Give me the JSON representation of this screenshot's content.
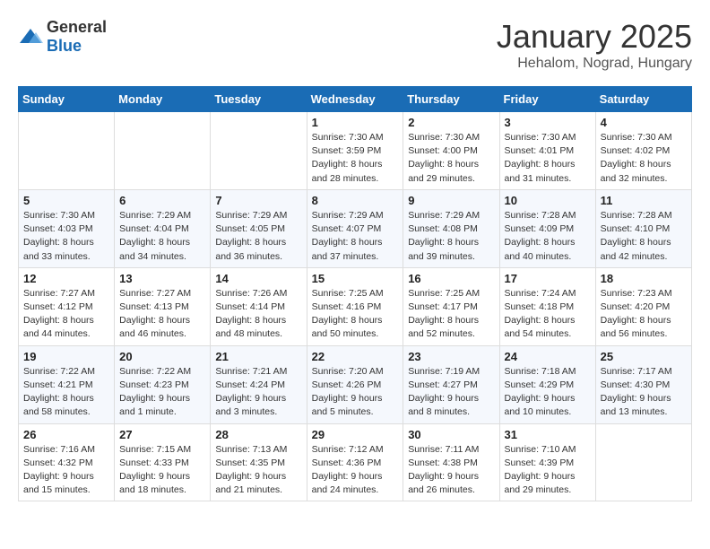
{
  "header": {
    "logo": {
      "general": "General",
      "blue": "Blue"
    },
    "title": "January 2025",
    "location": "Hehalom, Nograd, Hungary"
  },
  "weekdays": [
    "Sunday",
    "Monday",
    "Tuesday",
    "Wednesday",
    "Thursday",
    "Friday",
    "Saturday"
  ],
  "weeks": [
    [
      {
        "day": null,
        "detail": null
      },
      {
        "day": null,
        "detail": null
      },
      {
        "day": null,
        "detail": null
      },
      {
        "day": "1",
        "detail": "Sunrise: 7:30 AM\nSunset: 3:59 PM\nDaylight: 8 hours\nand 28 minutes."
      },
      {
        "day": "2",
        "detail": "Sunrise: 7:30 AM\nSunset: 4:00 PM\nDaylight: 8 hours\nand 29 minutes."
      },
      {
        "day": "3",
        "detail": "Sunrise: 7:30 AM\nSunset: 4:01 PM\nDaylight: 8 hours\nand 31 minutes."
      },
      {
        "day": "4",
        "detail": "Sunrise: 7:30 AM\nSunset: 4:02 PM\nDaylight: 8 hours\nand 32 minutes."
      }
    ],
    [
      {
        "day": "5",
        "detail": "Sunrise: 7:30 AM\nSunset: 4:03 PM\nDaylight: 8 hours\nand 33 minutes."
      },
      {
        "day": "6",
        "detail": "Sunrise: 7:29 AM\nSunset: 4:04 PM\nDaylight: 8 hours\nand 34 minutes."
      },
      {
        "day": "7",
        "detail": "Sunrise: 7:29 AM\nSunset: 4:05 PM\nDaylight: 8 hours\nand 36 minutes."
      },
      {
        "day": "8",
        "detail": "Sunrise: 7:29 AM\nSunset: 4:07 PM\nDaylight: 8 hours\nand 37 minutes."
      },
      {
        "day": "9",
        "detail": "Sunrise: 7:29 AM\nSunset: 4:08 PM\nDaylight: 8 hours\nand 39 minutes."
      },
      {
        "day": "10",
        "detail": "Sunrise: 7:28 AM\nSunset: 4:09 PM\nDaylight: 8 hours\nand 40 minutes."
      },
      {
        "day": "11",
        "detail": "Sunrise: 7:28 AM\nSunset: 4:10 PM\nDaylight: 8 hours\nand 42 minutes."
      }
    ],
    [
      {
        "day": "12",
        "detail": "Sunrise: 7:27 AM\nSunset: 4:12 PM\nDaylight: 8 hours\nand 44 minutes."
      },
      {
        "day": "13",
        "detail": "Sunrise: 7:27 AM\nSunset: 4:13 PM\nDaylight: 8 hours\nand 46 minutes."
      },
      {
        "day": "14",
        "detail": "Sunrise: 7:26 AM\nSunset: 4:14 PM\nDaylight: 8 hours\nand 48 minutes."
      },
      {
        "day": "15",
        "detail": "Sunrise: 7:25 AM\nSunset: 4:16 PM\nDaylight: 8 hours\nand 50 minutes."
      },
      {
        "day": "16",
        "detail": "Sunrise: 7:25 AM\nSunset: 4:17 PM\nDaylight: 8 hours\nand 52 minutes."
      },
      {
        "day": "17",
        "detail": "Sunrise: 7:24 AM\nSunset: 4:18 PM\nDaylight: 8 hours\nand 54 minutes."
      },
      {
        "day": "18",
        "detail": "Sunrise: 7:23 AM\nSunset: 4:20 PM\nDaylight: 8 hours\nand 56 minutes."
      }
    ],
    [
      {
        "day": "19",
        "detail": "Sunrise: 7:22 AM\nSunset: 4:21 PM\nDaylight: 8 hours\nand 58 minutes."
      },
      {
        "day": "20",
        "detail": "Sunrise: 7:22 AM\nSunset: 4:23 PM\nDaylight: 9 hours\nand 1 minute."
      },
      {
        "day": "21",
        "detail": "Sunrise: 7:21 AM\nSunset: 4:24 PM\nDaylight: 9 hours\nand 3 minutes."
      },
      {
        "day": "22",
        "detail": "Sunrise: 7:20 AM\nSunset: 4:26 PM\nDaylight: 9 hours\nand 5 minutes."
      },
      {
        "day": "23",
        "detail": "Sunrise: 7:19 AM\nSunset: 4:27 PM\nDaylight: 9 hours\nand 8 minutes."
      },
      {
        "day": "24",
        "detail": "Sunrise: 7:18 AM\nSunset: 4:29 PM\nDaylight: 9 hours\nand 10 minutes."
      },
      {
        "day": "25",
        "detail": "Sunrise: 7:17 AM\nSunset: 4:30 PM\nDaylight: 9 hours\nand 13 minutes."
      }
    ],
    [
      {
        "day": "26",
        "detail": "Sunrise: 7:16 AM\nSunset: 4:32 PM\nDaylight: 9 hours\nand 15 minutes."
      },
      {
        "day": "27",
        "detail": "Sunrise: 7:15 AM\nSunset: 4:33 PM\nDaylight: 9 hours\nand 18 minutes."
      },
      {
        "day": "28",
        "detail": "Sunrise: 7:13 AM\nSunset: 4:35 PM\nDaylight: 9 hours\nand 21 minutes."
      },
      {
        "day": "29",
        "detail": "Sunrise: 7:12 AM\nSunset: 4:36 PM\nDaylight: 9 hours\nand 24 minutes."
      },
      {
        "day": "30",
        "detail": "Sunrise: 7:11 AM\nSunset: 4:38 PM\nDaylight: 9 hours\nand 26 minutes."
      },
      {
        "day": "31",
        "detail": "Sunrise: 7:10 AM\nSunset: 4:39 PM\nDaylight: 9 hours\nand 29 minutes."
      },
      {
        "day": null,
        "detail": null
      }
    ]
  ]
}
